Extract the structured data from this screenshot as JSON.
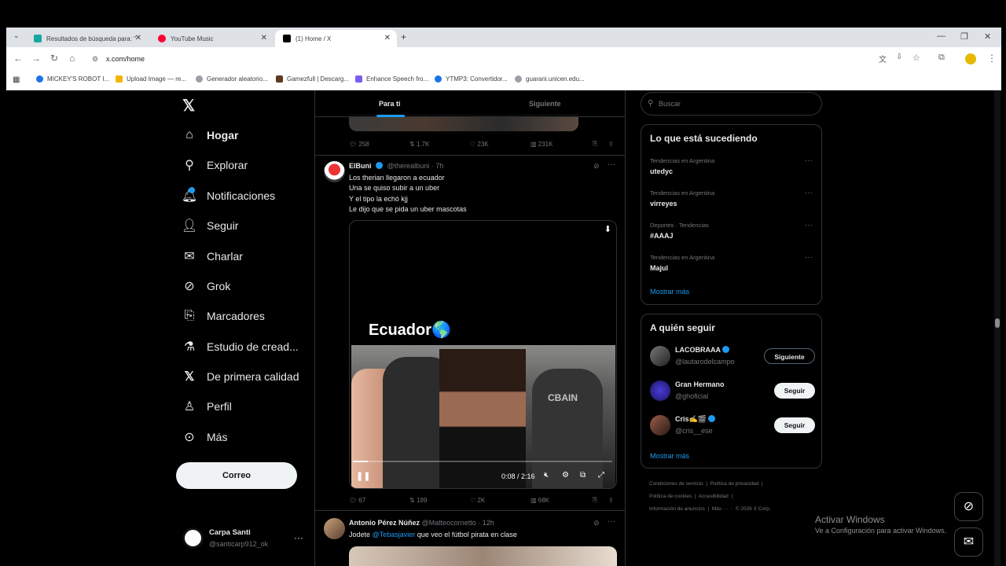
{
  "browser": {
    "tabs": [
      {
        "title": "Resultados de búsqueda para: \"",
        "fav": "#19a7a0"
      },
      {
        "title": "YouTube Music",
        "fav": "#ff0033"
      },
      {
        "title": "(1) Home / X",
        "fav": "#000000"
      }
    ],
    "url": "x.com/home",
    "bookmarks": [
      "MICKEY'S ROBOT I...",
      "Upload Image — re...",
      "Generador aleatorio...",
      "Gamezfull | Descarg...",
      "Enhance Speech fro...",
      "YTMP3: Convertidor...",
      "guarani.unicen.edu..."
    ]
  },
  "nav": {
    "items": [
      "Hogar",
      "Explorar",
      "Notificaciones",
      "Seguir",
      "Charlar",
      "Grok",
      "Marcadores",
      "Estudio de cread...",
      "De primera calidad",
      "Perfil",
      "Más"
    ],
    "post_button": "Correo",
    "account": {
      "name": "Carpa Santi",
      "handle": "@santicarp912_ok"
    }
  },
  "timeline": {
    "tabs": [
      "Para ti",
      "Siguiente"
    ],
    "prev_actions": {
      "replies": "258",
      "reposts": "1.7K",
      "likes": "23K",
      "views": "231K"
    },
    "tweet": {
      "name": "ElBuni",
      "handle": "@therealbuni",
      "time": "· 7h",
      "text": "Los therian llegaron a ecuador\nUna se quiso subir a un uber\nY el tipo la echó kjj\nLe dijo que se pida un uber mascotas",
      "video_caption": "Ecuador🌎",
      "watermark": "CBAIN",
      "video_time": "0:08 / 2:16",
      "actions": {
        "replies": "67",
        "reposts": "199",
        "likes": "2K",
        "views": "68K"
      }
    },
    "next": {
      "name": "Antonio Pérez Núñez",
      "handle": "@Matteocornetto",
      "time": "· 12h",
      "text_a": "Jodete",
      "mention": "@Tebasjavier",
      "text_b": "que veo el fútbol pirata en clase"
    }
  },
  "sidebar": {
    "search_placeholder": "Buscar",
    "trending_title": "Lo que está sucediendo",
    "trends": [
      {
        "context": "Tendencias en Argentina",
        "name": "utedyc"
      },
      {
        "context": "Tendencias en Argentina",
        "name": "virreyes"
      },
      {
        "context": "Deportes · Tendencias",
        "name": "#AAAJ"
      },
      {
        "context": "Tendencias en Argentina",
        "name": "Majul"
      }
    ],
    "show_more": "Mostrar más",
    "follow_title": "A quién seguir",
    "follow": [
      {
        "name": "LACOBRAAA",
        "handle": "@lautarodelcampo",
        "button": "Siguiente"
      },
      {
        "name": "Gran Hermano",
        "handle": "@ghoficial",
        "button": "Seguir"
      },
      {
        "name": "Cris✍️🎬",
        "handle": "@cris__ese",
        "button": "Seguir"
      }
    ],
    "footer_row1": [
      "Condiciones de servicio",
      "Política de privacidad"
    ],
    "footer_row2": [
      "Política de cookies",
      "Accesibilidad"
    ],
    "footer_row3": [
      "Información de anuncios",
      "Más ···",
      "© 2026 X Corp."
    ]
  },
  "windows": {
    "line1": "Activar Windows",
    "line2": "Ve a Configuración para activar Windows."
  }
}
